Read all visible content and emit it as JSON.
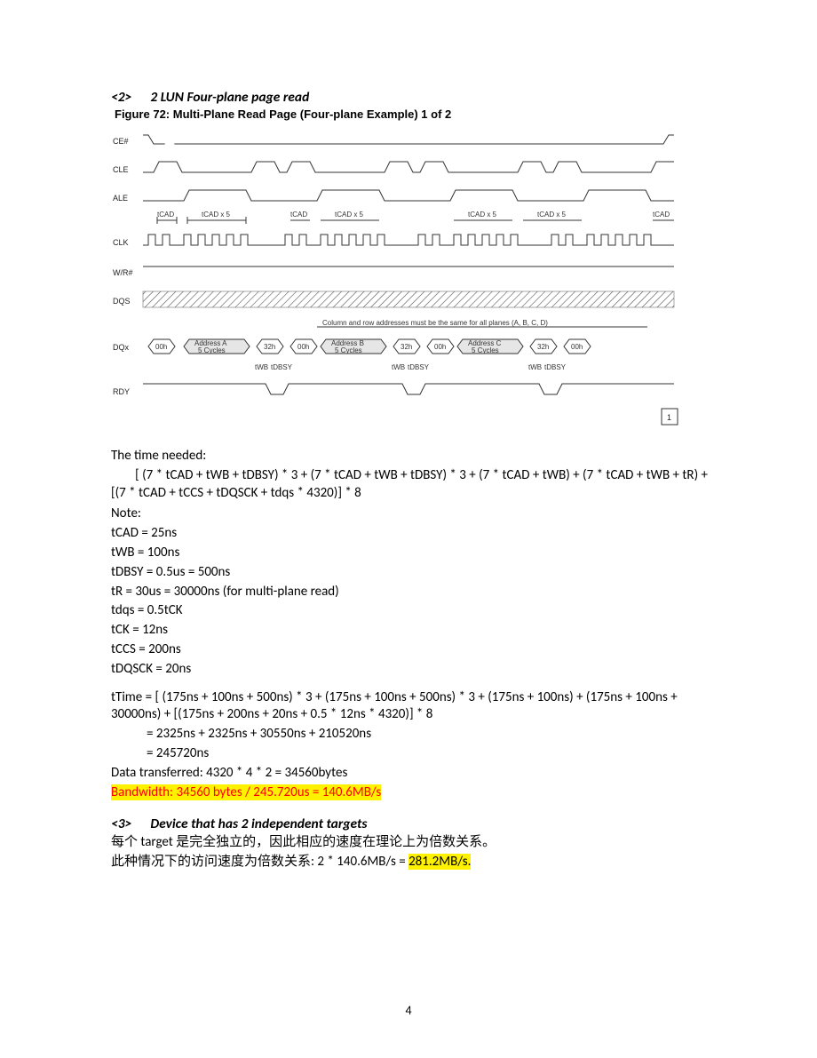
{
  "section2": {
    "num": "<2>",
    "title": "2 LUN Four-plane page read",
    "figure_label": "Figure 72:   Multi-Plane Read Page (Four-plane Example) 1 of 2"
  },
  "diagram": {
    "signals": [
      "CE#",
      "CLE",
      "ALE",
      "CLK",
      "W/R#",
      "DQS",
      "DQx",
      "RDY"
    ],
    "tcad_labels": [
      "tCAD",
      "tCAD x 5",
      "tCAD",
      "tCAD x 5",
      "tCAD x 5",
      "tCAD x 5",
      "tCAD"
    ],
    "address_text": "Column and row addresses must be the same for all planes (A, B, C, D)",
    "dqx_seq": [
      "00h",
      "Address A\n5 Cycles",
      "32h",
      "00h",
      "Address B\n5 Cycles",
      "32h",
      "00h",
      "Address C\n5 Cycles",
      "32h",
      "00h"
    ],
    "rdy_labels": [
      "tWB",
      "tDBSY",
      "tWB",
      "tDBSY",
      "tWB",
      "tDBSY"
    ],
    "corner": "1"
  },
  "time_needed_label": "The time needed:",
  "formula_line": "        [ (7 * tCAD + tWB + tDBSY) * 3 + (7 * tCAD + tWB + tDBSY) * 3 + (7 * tCAD + tWB) + (7 * tCAD + tWB + tR) + [(7 * tCAD + tCCS + tDQSCK + tdqs * 4320)] * 8",
  "note_label": "Note:",
  "notes": [
    "tCAD = 25ns",
    "tWB = 100ns",
    "tDBSY = 0.5us = 500ns",
    "tR = 30us = 30000ns (for multi-plane read)",
    "tdqs = 0.5tCK",
    "tCK = 12ns",
    "tCCS = 200ns",
    "tDQSCK = 20ns"
  ],
  "ttime1": "tTime = [ (175ns + 100ns + 500ns) * 3 + (175ns + 100ns + 500ns) * 3 + (175ns + 100ns) + (175ns + 100ns + 30000ns) + [(175ns + 200ns + 20ns + 0.5 * 12ns * 4320)] * 8",
  "ttime2": "= 2325ns + 2325ns + 30550ns + 210520ns",
  "ttime3": "= 245720ns",
  "data_transferred": "Data transferred: 4320 * 4 * 2 = 34560bytes",
  "bandwidth": "Bandwidth: 34560 bytes / 245.720us = 140.6MB/s",
  "section3": {
    "num": "<3>",
    "title": "Device that has 2 independent targets",
    "line1": "每个 target 是完全独立的，因此相应的速度在理论上为倍数关系。",
    "line2a": "此种情况下的访问速度为倍数关系: 2 * 140.6MB/s = ",
    "line2b": "281.2MB/s."
  },
  "page_number": "4"
}
